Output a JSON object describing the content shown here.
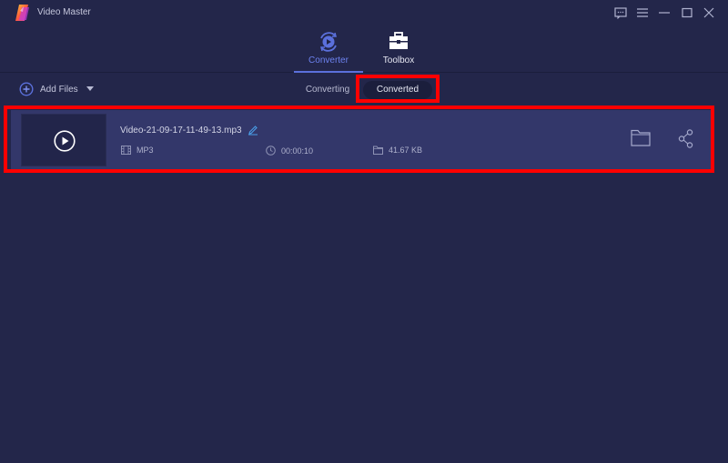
{
  "window": {
    "title": "Video Master",
    "controls": [
      {
        "name": "feedback",
        "icon": "chat-bubble-icon"
      },
      {
        "name": "menu",
        "icon": "hamburger-menu-icon"
      },
      {
        "name": "minimize",
        "icon": "minimize-icon"
      },
      {
        "name": "maximize",
        "icon": "maximize-icon"
      },
      {
        "name": "close",
        "icon": "close-icon"
      }
    ]
  },
  "nav": {
    "tabs": [
      {
        "label": "Converter",
        "icon": "converter-play-icon",
        "active": true
      },
      {
        "label": "Toolbox",
        "icon": "toolbox-icon",
        "active": false
      }
    ]
  },
  "toolbar": {
    "add_files_label": "Add Files",
    "segments": [
      {
        "label": "Converting",
        "active": false
      },
      {
        "label": "Converted",
        "active": true
      }
    ]
  },
  "files": [
    {
      "name": "Video-21-09-17-11-49-13.mp3",
      "format": "MP3",
      "duration": "00:00:10",
      "size": "41.67 KB",
      "actions": [
        "open-folder",
        "share"
      ]
    }
  ],
  "colors": {
    "background": "#23264a",
    "row": "#33376a",
    "accent": "#5b70dc",
    "annotation": "#ff0000"
  }
}
